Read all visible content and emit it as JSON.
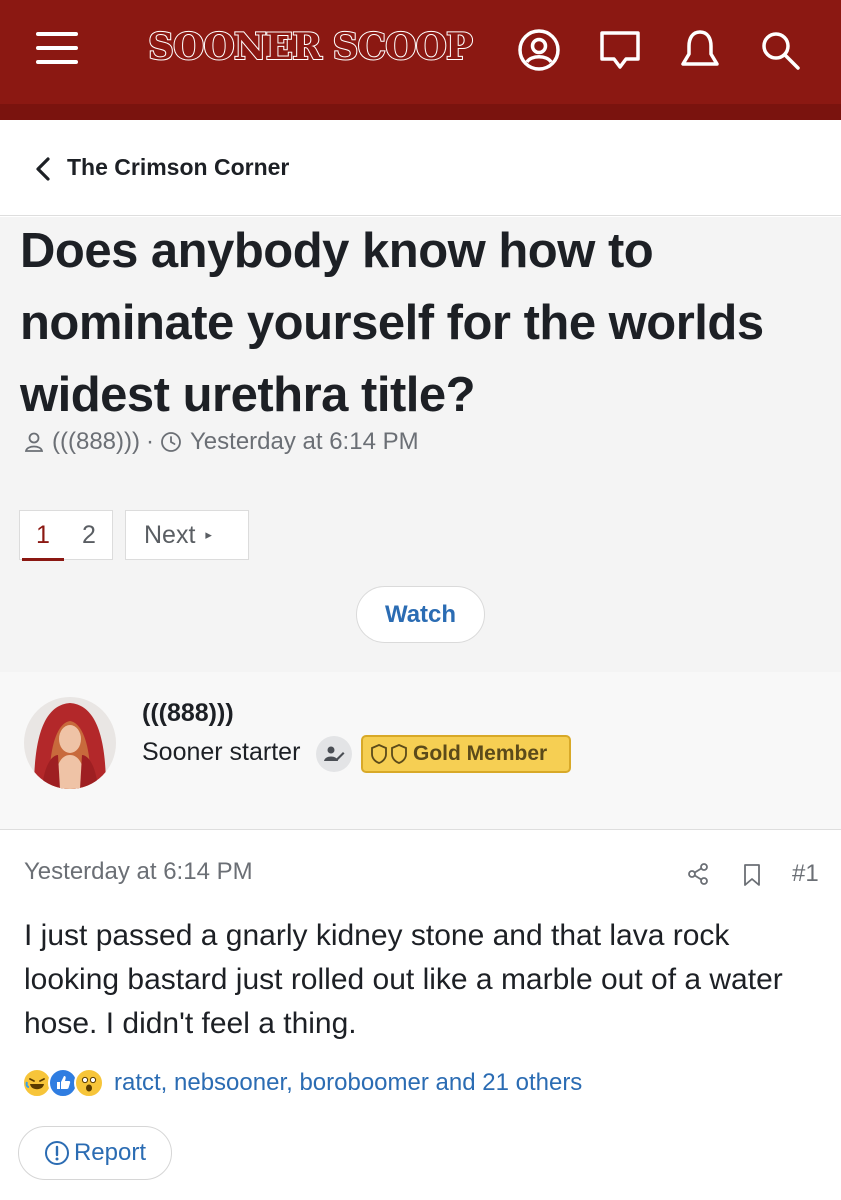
{
  "header": {
    "logo_text": "SOONER SCOOP",
    "bar_color": "#8b1812",
    "icons": [
      "menu-icon",
      "account-icon",
      "chat-icon",
      "alerts-icon",
      "search-icon"
    ]
  },
  "breadcrumb": {
    "label": "The Crimson Corner"
  },
  "thread": {
    "title": "Does anybody know how to nominate yourself for the worlds widest urethra title?",
    "author": "(((888)))",
    "separator": "·",
    "date": "Yesterday at 6:14 PM"
  },
  "pagination": {
    "pages": [
      "1",
      "2"
    ],
    "current": "1",
    "next_label": "Next"
  },
  "watch_label": "Watch",
  "post": {
    "username": "(((888)))",
    "user_title": "Sooner starter",
    "badge": "Gold Member",
    "date": "Yesterday at 6:14 PM",
    "number": "#1",
    "body": "I just passed a gnarly kidney stone and that lava rock looking bastard just rolled out like a marble out of a water hose. I didn't feel a thing.",
    "reactions": {
      "icons": [
        "laughing-emoji-icon",
        "like-thumb-icon",
        "wow-emoji-icon"
      ],
      "text": "ratct, nebsooner, boroboomer and 21 others"
    },
    "report_label": "Report"
  },
  "colors": {
    "accent": "#8b1812",
    "link": "#2b6cb3",
    "gold": "#f6cf53"
  }
}
